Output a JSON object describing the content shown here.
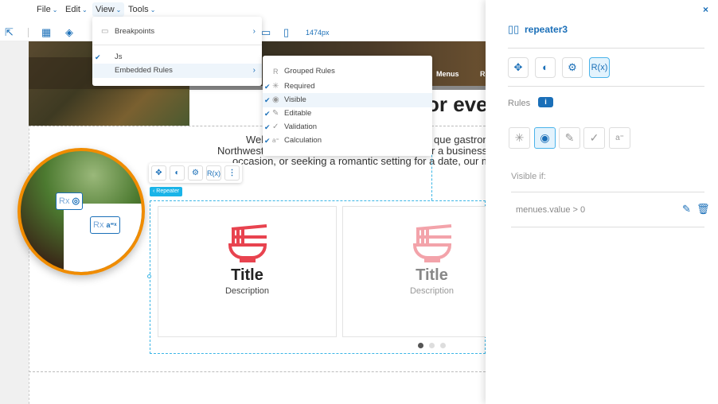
{
  "menubar": {
    "items": [
      {
        "label": "File"
      },
      {
        "label": "Edit"
      },
      {
        "label": "View"
      },
      {
        "label": "Tools"
      }
    ]
  },
  "toolbar": {
    "width_readout": "1474px"
  },
  "view_menu": {
    "items": [
      {
        "label": "Breakpoints",
        "icon": "monitor-icon",
        "submenu": true
      },
      {
        "label": "Js",
        "checked": true
      },
      {
        "label": "Embedded Rules",
        "submenu": true,
        "highlighted": true
      }
    ]
  },
  "rules_submenu": {
    "items": [
      {
        "label": "Grouped Rules",
        "icon": "rx-icon",
        "checked": false
      },
      {
        "label": "Required",
        "icon": "asterisk-icon",
        "checked": true
      },
      {
        "label": "Visible",
        "icon": "eye-icon",
        "checked": true,
        "highlighted": true
      },
      {
        "label": "Editable",
        "icon": "pencil-icon",
        "checked": true
      },
      {
        "label": "Validation",
        "icon": "check-icon",
        "checked": true
      },
      {
        "label": "Calculation",
        "icon": "calculation-icon",
        "checked": true
      }
    ]
  },
  "site": {
    "nav_links": [
      "Menus",
      "R"
    ],
    "heading": "or ever",
    "welcome_lines": [
      "Wel",
      "que gastronc",
      "Northwest",
      "r a business",
      "occasion, or seeking a romantic setting for a date, our mer"
    ]
  },
  "magnifier": {
    "badge1": "Rx",
    "badge2": "Rx"
  },
  "component_toolbar": {
    "rx_label": "R(x)",
    "tag": "‹ Repeater"
  },
  "cards": [
    {
      "title": "Title",
      "description": "Description"
    },
    {
      "title": "Title",
      "description": "Description"
    }
  ],
  "carousel": {
    "pages": 3,
    "active": 1
  },
  "panel": {
    "title": "repeater3",
    "close": "×",
    "rx_label": "R(x)",
    "rules_label": "Rules",
    "info": "i",
    "visible_if_label": "Visible if:",
    "rule_expression": "menues.value > 0"
  },
  "colors": {
    "accent": "#1a6fb8",
    "highlight": "#1ab4e8",
    "magnifier_ring": "#f08c00",
    "icon_red": "#e8434f"
  }
}
